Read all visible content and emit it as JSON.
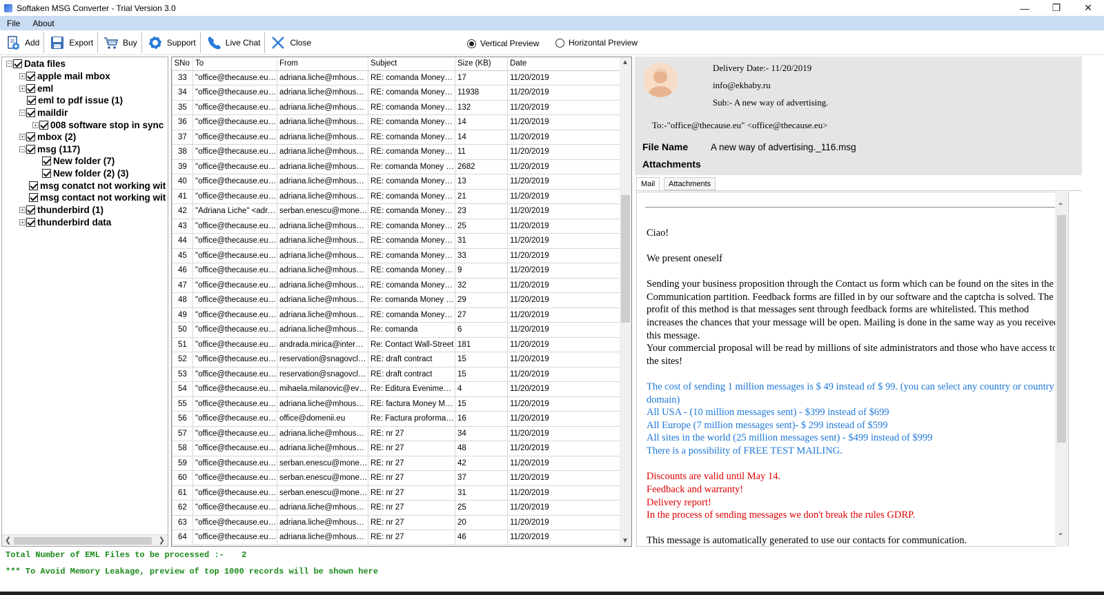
{
  "window": {
    "title": "Softaken MSG Converter - Trial Version 3.0",
    "minimize": "—",
    "maximize": "❐",
    "close": "✕"
  },
  "menu": {
    "file": "File",
    "about": "About"
  },
  "toolbar": {
    "add": "Add",
    "export": "Export",
    "buy": "Buy",
    "support": "Support",
    "live_chat": "Live Chat",
    "close": "Close"
  },
  "preview_mode": {
    "vertical": "Vertical Preview",
    "horizontal": "Horizontal Preview",
    "selected": "vertical"
  },
  "tree": {
    "root": "Data files",
    "items": [
      {
        "label": "apple mail mbox"
      },
      {
        "label": "eml"
      },
      {
        "label": "eml to pdf issue (1)"
      },
      {
        "label": "maildir"
      },
      {
        "label": "008 software stop in sync"
      },
      {
        "label": "mbox (2)"
      },
      {
        "label": "msg (117)"
      },
      {
        "label": "New folder (7)"
      },
      {
        "label": "New folder (2) (3)"
      },
      {
        "label": "msg conatct not working wit"
      },
      {
        "label": "msg contact not working wit"
      },
      {
        "label": "thunderbird (1)"
      },
      {
        "label": "thunderbird data"
      }
    ]
  },
  "table": {
    "headers": [
      "SNo",
      "To",
      "From",
      "Subject",
      "Size (KB)",
      "Date"
    ],
    "rows": [
      [
        "33",
        "\"office@thecause.eu\" <office@thecause.eu>",
        "adriana.liche@mhouse.ro",
        "RE: comanda Money Mag",
        "17",
        "11/20/2019"
      ],
      [
        "34",
        "\"office@thecause.eu\" <office@thecause.eu>",
        "adriana.liche@mhouse.ro",
        "RE: comanda Money Mag",
        "11938",
        "11/20/2019"
      ],
      [
        "35",
        "\"office@thecause.eu\" <office@thecause.eu>",
        "adriana.liche@mhouse.ro",
        "RE: comanda Money Mag",
        "132",
        "11/20/2019"
      ],
      [
        "36",
        "\"office@thecause.eu\" <office@thecause.eu>",
        "adriana.liche@mhouse.ro",
        "RE: comanda Money Mag",
        "14",
        "11/20/2019"
      ],
      [
        "37",
        "\"office@thecause.eu\" <office@thecause.eu>",
        "adriana.liche@mhouse.ro",
        "RE: comanda Money Mag",
        "14",
        "11/20/2019"
      ],
      [
        "38",
        "\"office@thecause.eu\" <office@thecause.eu>",
        "adriana.liche@mhouse.ro",
        "RE: comanda Money Mag",
        "11",
        "11/20/2019"
      ],
      [
        "39",
        "\"office@thecause.eu\" <office@thecause.eu>",
        "adriana.liche@mhouse.ro",
        "Re: comanda Money Mag",
        "2682",
        "11/20/2019"
      ],
      [
        "40",
        "\"office@thecause.eu\" <office@thecause.eu>",
        "adriana.liche@mhouse.ro",
        "RE: comanda Money Mag",
        "13",
        "11/20/2019"
      ],
      [
        "41",
        "\"office@thecause.eu\" <office@thecause.eu>",
        "adriana.liche@mhouse.ro",
        "RE: comanda Money Mag",
        "21",
        "11/20/2019"
      ],
      [
        "42",
        "\"Adriana Liche\" <adriana.liche@mhouse.ro>",
        "serban.enescu@money.ro",
        "RE: comanda Money Mag",
        "23",
        "11/20/2019"
      ],
      [
        "43",
        "\"office@thecause.eu\" <office@thecause.eu>",
        "adriana.liche@mhouse.ro",
        "RE: comanda Money Mag",
        "25",
        "11/20/2019"
      ],
      [
        "44",
        "\"office@thecause.eu\" <office@thecause.eu>",
        "adriana.liche@mhouse.ro",
        "RE: comanda Money Mag",
        "31",
        "11/20/2019"
      ],
      [
        "45",
        "\"office@thecause.eu\" <office@thecause.eu>",
        "adriana.liche@mhouse.ro",
        "RE: comanda Money Mag",
        "33",
        "11/20/2019"
      ],
      [
        "46",
        "\"office@thecause.eu\" <office@thecause.eu>",
        "adriana.liche@mhouse.ro",
        "RE: comanda Money Mag",
        "9",
        "11/20/2019"
      ],
      [
        "47",
        "\"office@thecause.eu\" <office@thecause.eu>",
        "adriana.liche@mhouse.ro",
        "RE: comanda Money Mag",
        "32",
        "11/20/2019"
      ],
      [
        "48",
        "\"office@thecause.eu\" <office@thecause.eu>",
        "adriana.liche@mhouse.ro",
        "Re: comanda Money Mag",
        "29",
        "11/20/2019"
      ],
      [
        "49",
        "\"office@thecause.eu\" <office@thecause.eu>",
        "adriana.liche@mhouse.ro",
        "RE: comanda Money Mag",
        "27",
        "11/20/2019"
      ],
      [
        "50",
        "\"office@thecause.eu\" <office@thecause.eu>",
        "adriana.liche@mhouse.ro",
        "Re: comanda",
        "6",
        "11/20/2019"
      ],
      [
        "51",
        "\"office@thecause.eu\" <office@thecause.eu>",
        "andrada.mirica@internetsolutions.ro",
        "Re: Contact Wall-Street",
        "181",
        "11/20/2019"
      ],
      [
        "52",
        "\"office@thecause.eu\" <office@thecause.eu>",
        "reservation@snagovclub.ro",
        "RE: draft contract",
        "15",
        "11/20/2019"
      ],
      [
        "53",
        "\"office@thecause.eu\" <office@thecause.eu>",
        "reservation@snagovclub.ro",
        "RE: draft contract",
        "15",
        "11/20/2019"
      ],
      [
        "54",
        "\"office@thecause.eu\" <office@thecause.eu>",
        "mihaela.milanovic@evzgroup.ro",
        "Re: Editura Evenimentul Zilei",
        "4",
        "11/20/2019"
      ],
      [
        "55",
        "\"office@thecause.eu\" <office@thecause.eu>",
        "adriana.liche@mhouse.ro",
        "RE: factura Money Magazine",
        "15",
        "11/20/2019"
      ],
      [
        "56",
        "\"office@thecause.eu\" <office@thecause.eu>",
        "office@domenii.eu",
        "Re: Factura proforma nr",
        "16",
        "11/20/2019"
      ],
      [
        "57",
        "\"office@thecause.eu\" <office@thecause.eu>",
        "adriana.liche@mhouse.ro",
        "RE: nr 27",
        "34",
        "11/20/2019"
      ],
      [
        "58",
        "\"office@thecause.eu\" <office@thecause.eu>",
        "adriana.liche@mhouse.ro",
        "RE: nr 27",
        "48",
        "11/20/2019"
      ],
      [
        "59",
        "\"office@thecause.eu\" <office@thecause.eu>",
        "serban.enescu@money.ro",
        "RE: nr 27",
        "42",
        "11/20/2019"
      ],
      [
        "60",
        "\"office@thecause.eu\" <office@thecause.eu>",
        "serban.enescu@money.ro",
        "RE: nr 27",
        "37",
        "11/20/2019"
      ],
      [
        "61",
        "\"office@thecause.eu\" <office@thecause.eu>",
        "serban.enescu@money.ro",
        "RE: nr 27",
        "31",
        "11/20/2019"
      ],
      [
        "62",
        "\"office@thecause.eu\" <office@thecause.eu>",
        "adriana.liche@mhouse.ro",
        "RE: nr 27",
        "25",
        "11/20/2019"
      ],
      [
        "63",
        "\"office@thecause.eu\" <office@thecause.eu>",
        "adriana.liche@mhouse.ro",
        "RE: nr 27",
        "20",
        "11/20/2019"
      ],
      [
        "64",
        "\"office@thecause.eu\" <office@thecause.eu>",
        "adriana.liche@mhouse.ro",
        "RE: nr 27",
        "46",
        "11/20/2019"
      ]
    ]
  },
  "preview": {
    "delivery_date": "Delivery Date:- 11/20/2019",
    "from_email": "info@ekbaby.ru",
    "subject": "Sub:- A new way of advertising.",
    "to": "To:-\"office@thecause.eu\" <office@thecause.eu>",
    "file_name_label": "File Name",
    "file_name_value": "A new way of advertising._116.msg",
    "attachments_label": "Attachments",
    "tab_mail": "Mail",
    "tab_attachments": "Attachments",
    "body": {
      "greeting": "Ciao!",
      "intro": "We present oneself",
      "para1": "Sending your business proposition through the Contact us form which can be found on the sites in the Communication partition. Feedback forms are filled in by our software and the captcha is solved. The profit of this method is that messages sent through feedback forms are whitelisted. This method increases the chances that your message will be open. Mailing is done in the same way as you received this message.",
      "para2": "Your  commercial proposal will be read by millions of site administrators and those who have access to the sites!",
      "blue1": "The cost of sending 1 million messages is $ 49 instead of $ 99. (you can select any country or country domain)",
      "blue2": "All USA - (10 million messages sent) - $399 instead of $699",
      "blue3": "All Europe (7 million messages sent)- $ 299 instead of $599",
      "blue4": "All sites in the world (25 million messages sent) - $499 instead of $999",
      "blue5": "There is a possibility of FREE TEST MAILING.",
      "red1": "Discounts are valid until May 14.",
      "red2": "Feedback and warranty!",
      "red3": "Delivery report!",
      "red4": "In the process of sending messages we don't break the rules GDRP.",
      "footer": "This message is automatically generated to use our contacts for communication."
    }
  },
  "status": {
    "total_label": "Total Number of EML Files to be processed :-",
    "total_value": "2",
    "memory_note": "*** To Avoid Memory Leakage, preview of top 1000 records will be shown here"
  },
  "colors": {
    "menubar": "#c9dcf3",
    "status_green": "#1a8a1a",
    "body_blue": "#1e78d8",
    "body_red": "#e00000",
    "preview_header": "#e5e5e5"
  },
  "icons": [
    "add-icon",
    "export-icon",
    "buy-cart-icon",
    "support-icon",
    "live-chat-phone-icon",
    "close-x-icon",
    "user-avatar-icon"
  ]
}
